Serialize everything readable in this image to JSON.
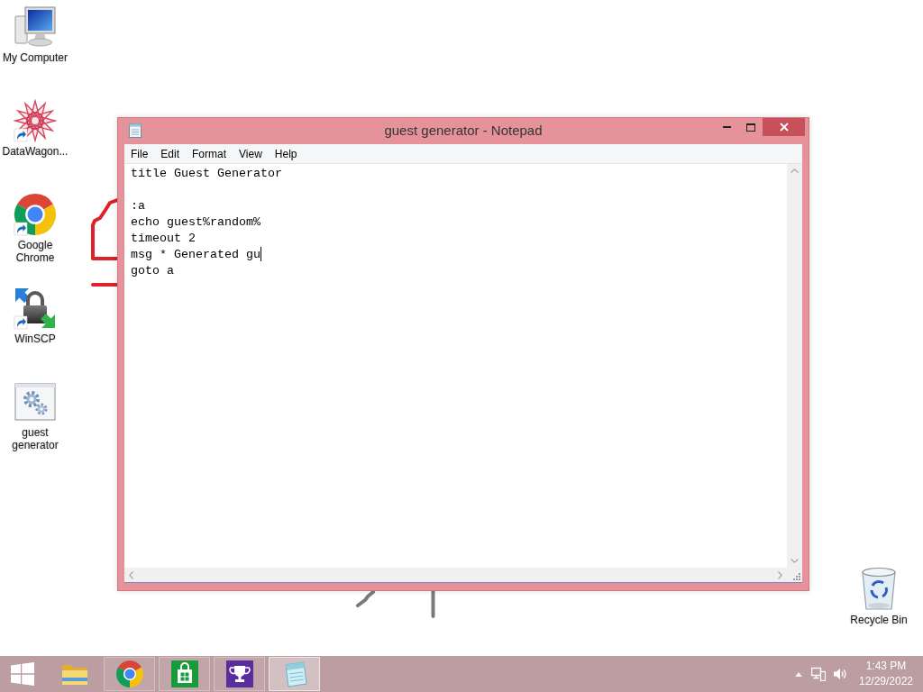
{
  "desktop_icons": [
    {
      "kind": "computer",
      "label": "My Computer",
      "shortcut": false
    },
    {
      "kind": "star",
      "label": "DataWagon...",
      "shortcut": true
    },
    {
      "kind": "chrome",
      "label": "Google Chrome",
      "shortcut": true
    },
    {
      "kind": "lock",
      "label": "WinSCP",
      "shortcut": true
    },
    {
      "kind": "batch",
      "label": "guest generator",
      "shortcut": false
    }
  ],
  "recycle_bin": {
    "label": "Recycle Bin"
  },
  "window": {
    "title": "guest generator - Notepad",
    "menu": [
      "File",
      "Edit",
      "Format",
      "View",
      "Help"
    ],
    "editor": {
      "text_before_cursor": "title Guest Generator\n\n:a\necho guest%random%\ntimeout 2\nmsg * Generated gu",
      "text_after_cursor": "\ngoto a"
    }
  },
  "taskbar": {
    "items": [
      {
        "kind": "explorer",
        "running": false,
        "active": false
      },
      {
        "kind": "chrome",
        "running": true,
        "active": false
      },
      {
        "kind": "store",
        "running": true,
        "active": false
      },
      {
        "kind": "trophy",
        "running": true,
        "active": false
      },
      {
        "kind": "notepad",
        "running": true,
        "active": true
      }
    ],
    "clock": {
      "time": "1:43 PM",
      "date": "12/29/2022"
    }
  }
}
